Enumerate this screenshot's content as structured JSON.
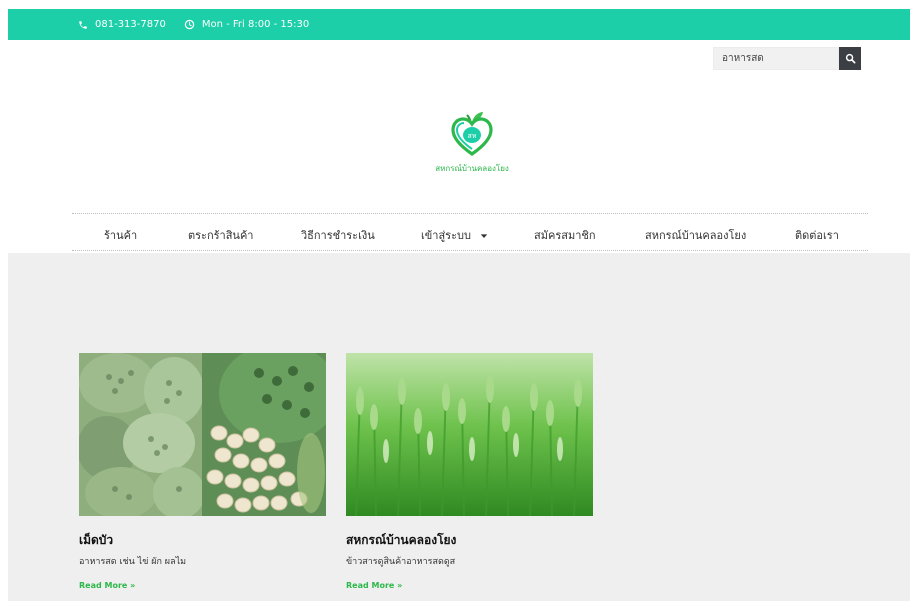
{
  "topbar": {
    "phone": "081-313-7870",
    "hours": "Mon - Fri 8:00 - 15:30",
    "phone_icon": "phone-icon",
    "clock_icon": "clock-icon"
  },
  "search": {
    "value": "อาหารสด",
    "icon": "search-icon"
  },
  "logo": {
    "badge": "สห",
    "brand": "สหกรณ์บ้านคลองโยง"
  },
  "nav": {
    "items": [
      "ร้านค้า",
      "ตระกร้าสินค้า",
      "วิธีการชำระเงิน",
      "เข้าสู่ระบบ",
      "สมัครสมาชิก",
      "สหกรณ์บ้านคลองโยง",
      "ติดต่อเรา"
    ]
  },
  "cards": [
    {
      "title": "เม็ดบัว",
      "desc": "อาหารสด เช่น ไข่ ผัก ผลไม",
      "more": "Read More »"
    },
    {
      "title": "สหกรณ์บ้านคลองโยง",
      "desc": "ข้าวสารดูสินค้าอาหารสดดูส",
      "more": "Read More »"
    }
  ],
  "colors": {
    "brand_teal": "#1dcfa8",
    "accent_green": "#2cb84a",
    "search_button": "#3b3f44",
    "content_bg": "#efefef"
  }
}
